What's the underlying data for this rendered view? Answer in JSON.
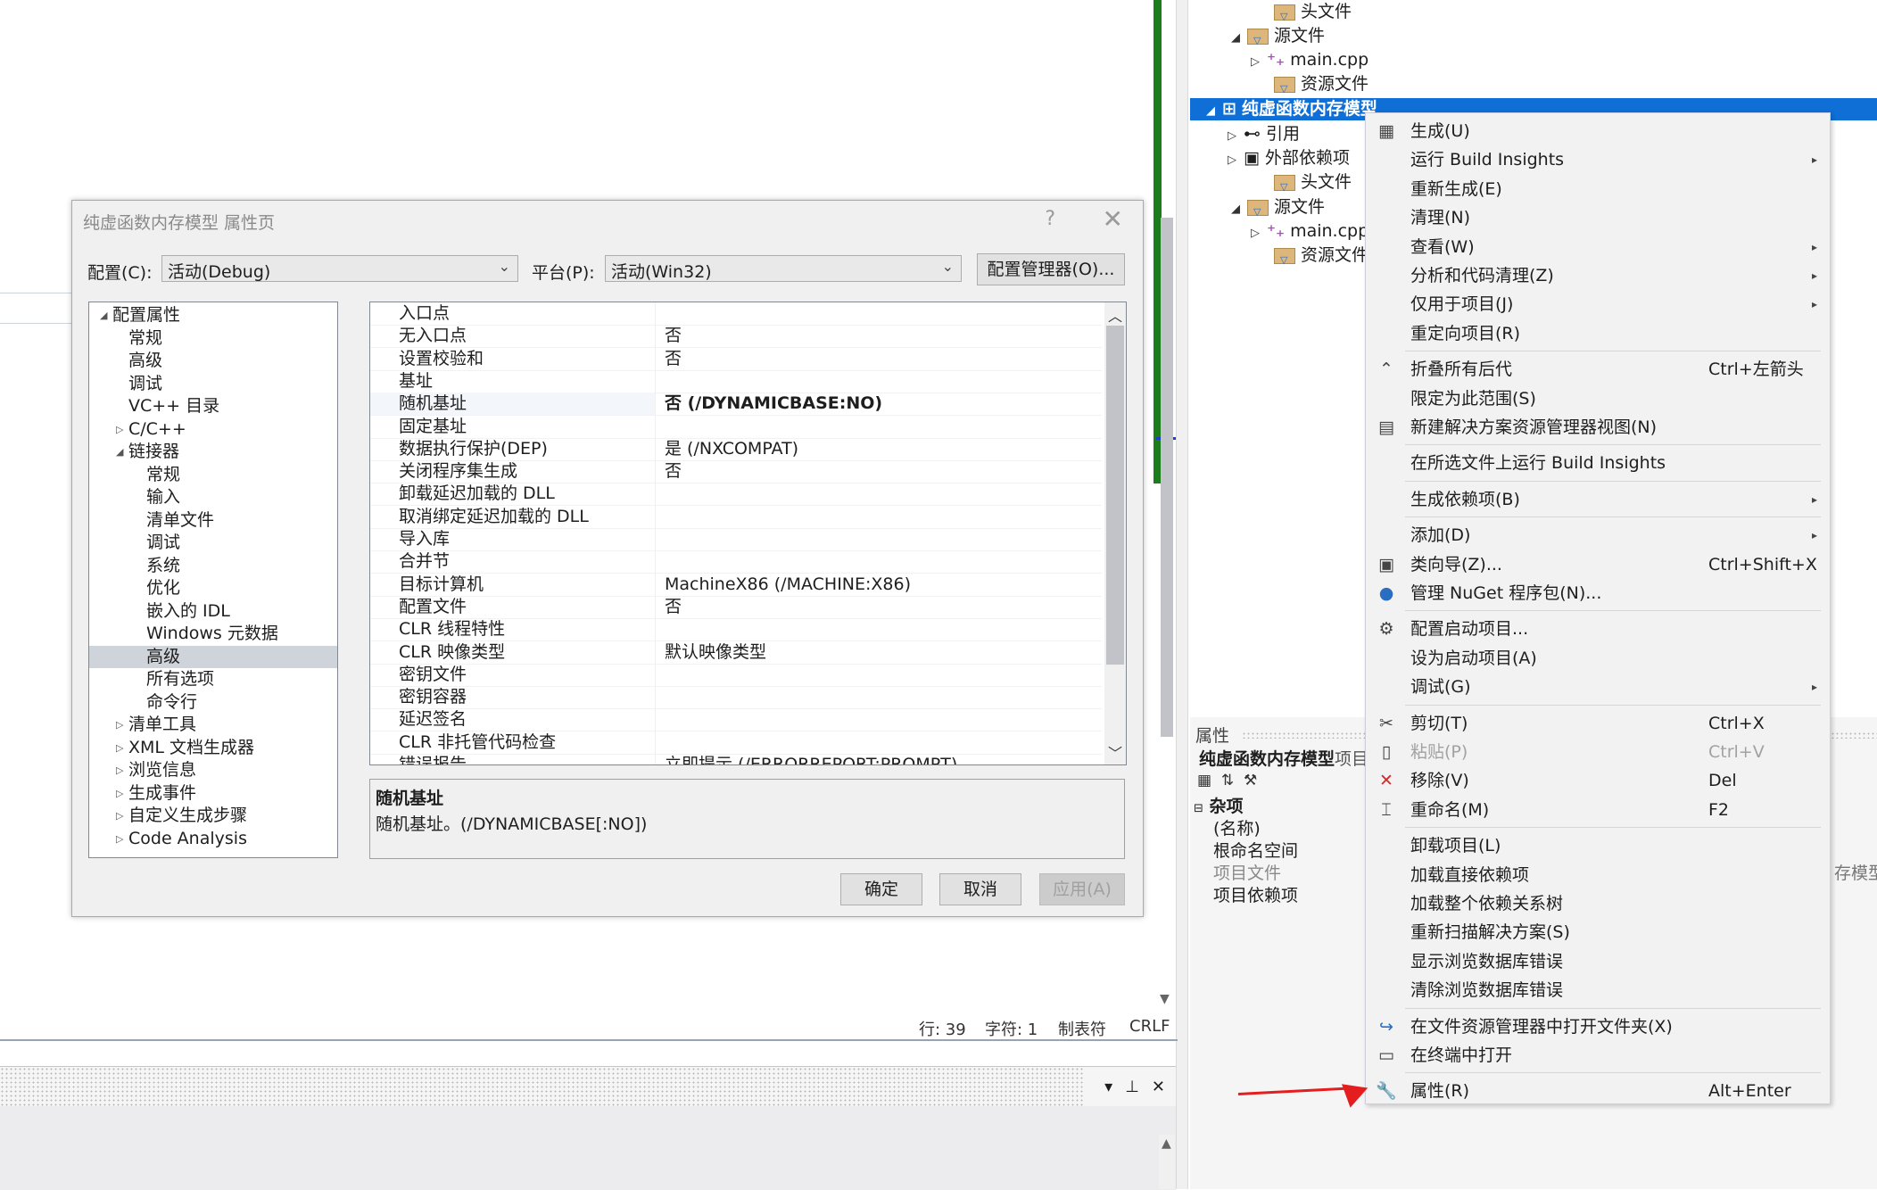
{
  "dialog": {
    "title": "纯虚函数内存模型 属性页",
    "help": "?",
    "close": "✕",
    "config_label": "配置(C):",
    "config_value": "活动(Debug)",
    "platform_label": "平台(P):",
    "platform_value": "活动(Win32)",
    "config_manager": "配置管理器(O)...",
    "tree": [
      {
        "label": "配置属性",
        "indent": 0,
        "toggle": "◢"
      },
      {
        "label": "常规",
        "indent": 1,
        "toggle": ""
      },
      {
        "label": "高级",
        "indent": 1,
        "toggle": ""
      },
      {
        "label": "调试",
        "indent": 1,
        "toggle": ""
      },
      {
        "label": "VC++ 目录",
        "indent": 1,
        "toggle": ""
      },
      {
        "label": "C/C++",
        "indent": 1,
        "toggle": "▷"
      },
      {
        "label": "链接器",
        "indent": 1,
        "toggle": "◢"
      },
      {
        "label": "常规",
        "indent": 2,
        "toggle": ""
      },
      {
        "label": "输入",
        "indent": 2,
        "toggle": ""
      },
      {
        "label": "清单文件",
        "indent": 2,
        "toggle": ""
      },
      {
        "label": "调试",
        "indent": 2,
        "toggle": ""
      },
      {
        "label": "系统",
        "indent": 2,
        "toggle": ""
      },
      {
        "label": "优化",
        "indent": 2,
        "toggle": ""
      },
      {
        "label": "嵌入的 IDL",
        "indent": 2,
        "toggle": ""
      },
      {
        "label": "Windows 元数据",
        "indent": 2,
        "toggle": ""
      },
      {
        "label": "高级",
        "indent": 2,
        "toggle": ""
      },
      {
        "label": "所有选项",
        "indent": 2,
        "toggle": ""
      },
      {
        "label": "命令行",
        "indent": 2,
        "toggle": ""
      },
      {
        "label": "清单工具",
        "indent": 1,
        "toggle": "▷"
      },
      {
        "label": "XML 文档生成器",
        "indent": 1,
        "toggle": "▷"
      },
      {
        "label": "浏览信息",
        "indent": 1,
        "toggle": "▷"
      },
      {
        "label": "生成事件",
        "indent": 1,
        "toggle": "▷"
      },
      {
        "label": "自定义生成步骤",
        "indent": 1,
        "toggle": "▷"
      },
      {
        "label": "Code Analysis",
        "indent": 1,
        "toggle": "▷"
      }
    ],
    "properties": [
      {
        "name": "入口点",
        "value": ""
      },
      {
        "name": "无入口点",
        "value": "否"
      },
      {
        "name": "设置校验和",
        "value": "否"
      },
      {
        "name": "基址",
        "value": ""
      },
      {
        "name": "随机基址",
        "value": "否 (/DYNAMICBASE:NO)"
      },
      {
        "name": "固定基址",
        "value": ""
      },
      {
        "name": "数据执行保护(DEP)",
        "value": "是 (/NXCOMPAT)"
      },
      {
        "name": "关闭程序集生成",
        "value": "否"
      },
      {
        "name": "卸载延迟加载的 DLL",
        "value": ""
      },
      {
        "name": "取消绑定延迟加载的 DLL",
        "value": ""
      },
      {
        "name": "导入库",
        "value": ""
      },
      {
        "name": "合并节",
        "value": ""
      },
      {
        "name": "目标计算机",
        "value": "MachineX86 (/MACHINE:X86)"
      },
      {
        "name": "配置文件",
        "value": "否"
      },
      {
        "name": "CLR 线程特性",
        "value": ""
      },
      {
        "name": "CLR 映像类型",
        "value": "默认映像类型"
      },
      {
        "name": "密钥文件",
        "value": ""
      },
      {
        "name": "密钥容器",
        "value": ""
      },
      {
        "name": "延迟签名",
        "value": ""
      },
      {
        "name": "CLR 非托管代码检查",
        "value": ""
      },
      {
        "name": "错误报告",
        "value": "立即提示 (/ERRORREPORT:PROMPT)"
      }
    ],
    "desc_title": "随机基址",
    "desc_text": "随机基址。(/DYNAMICBASE[:NO])",
    "ok": "确定",
    "cancel": "取消",
    "apply": "应用(A)"
  },
  "status": {
    "line": "行: 39",
    "char": "字符: 1",
    "tabs": "制表符",
    "eol": "CRLF"
  },
  "bottom_panel": {
    "dropdown": "▾",
    "pin": "⊥",
    "close": "✕"
  },
  "solution": {
    "items": [
      {
        "label": "头文件",
        "type": "folder",
        "arrow": ""
      },
      {
        "label": "源文件",
        "type": "folder",
        "arrow": "◢"
      },
      {
        "label": "main.cpp",
        "type": "cpp",
        "arrow": "▷"
      },
      {
        "label": "资源文件",
        "type": "folder",
        "arrow": ""
      },
      {
        "label": "纯虚函数内存模型",
        "type": "project",
        "arrow": "◢"
      },
      {
        "label": "引用",
        "type": "ref",
        "arrow": "▷"
      },
      {
        "label": "外部依赖项",
        "type": "ext",
        "arrow": "▷"
      },
      {
        "label": "头文件",
        "type": "folder",
        "arrow": ""
      },
      {
        "label": "源文件",
        "type": "folder",
        "arrow": "◢"
      },
      {
        "label": "main.cpp",
        "type": "cpp",
        "arrow": "▷"
      },
      {
        "label": "资源文件",
        "type": "folder",
        "arrow": ""
      }
    ]
  },
  "properties_panel": {
    "header": "属性",
    "object": "纯虚函数内存模型",
    "object_suffix": "项目",
    "group": "杂项",
    "rows": [
      "(名称)",
      "根命名空间",
      "项目文件",
      "项目依赖项"
    ],
    "right_value": "存模型"
  },
  "context_menu": {
    "items": [
      {
        "icon": "build-icon",
        "glyph": "▦",
        "label": "生成(U)",
        "shortcut": "",
        "sub": false,
        "disabled": false
      },
      {
        "icon": "",
        "glyph": "",
        "label": "运行 Build Insights",
        "shortcut": "",
        "sub": true,
        "disabled": false
      },
      {
        "icon": "",
        "glyph": "",
        "label": "重新生成(E)",
        "shortcut": "",
        "sub": false,
        "disabled": false
      },
      {
        "icon": "",
        "glyph": "",
        "label": "清理(N)",
        "shortcut": "",
        "sub": false,
        "disabled": false
      },
      {
        "icon": "",
        "glyph": "",
        "label": "查看(W)",
        "shortcut": "",
        "sub": true,
        "disabled": false
      },
      {
        "icon": "",
        "glyph": "",
        "label": "分析和代码清理(Z)",
        "shortcut": "",
        "sub": true,
        "disabled": false
      },
      {
        "icon": "",
        "glyph": "",
        "label": "仅用于项目(J)",
        "shortcut": "",
        "sub": true,
        "disabled": false
      },
      {
        "icon": "",
        "glyph": "",
        "label": "重定向项目(R)",
        "shortcut": "",
        "sub": false,
        "disabled": false
      },
      {
        "sep": true
      },
      {
        "icon": "collapse-icon",
        "glyph": "⌃",
        "label": "折叠所有后代",
        "shortcut": "Ctrl+左箭头",
        "sub": false,
        "disabled": false
      },
      {
        "icon": "",
        "glyph": "",
        "label": "限定为此范围(S)",
        "shortcut": "",
        "sub": false,
        "disabled": false
      },
      {
        "icon": "new-view-icon",
        "glyph": "▤",
        "label": "新建解决方案资源管理器视图(N)",
        "shortcut": "",
        "sub": false,
        "disabled": false
      },
      {
        "sep": true
      },
      {
        "icon": "",
        "glyph": "",
        "label": "在所选文件上运行 Build Insights",
        "shortcut": "",
        "sub": false,
        "disabled": false
      },
      {
        "sep": true
      },
      {
        "icon": "",
        "glyph": "",
        "label": "生成依赖项(B)",
        "shortcut": "",
        "sub": true,
        "disabled": false
      },
      {
        "sep": true
      },
      {
        "icon": "",
        "glyph": "",
        "label": "添加(D)",
        "shortcut": "",
        "sub": true,
        "disabled": false
      },
      {
        "icon": "class-wizard-icon",
        "glyph": "▣",
        "label": "类向导(Z)...",
        "shortcut": "Ctrl+Shift+X",
        "sub": false,
        "disabled": false
      },
      {
        "icon": "nuget-icon",
        "glyph": "●",
        "label": "管理 NuGet 程序包(N)...",
        "shortcut": "",
        "sub": false,
        "disabled": false
      },
      {
        "sep": true
      },
      {
        "icon": "gear-icon",
        "glyph": "⚙",
        "label": "配置启动项目...",
        "shortcut": "",
        "sub": false,
        "disabled": false
      },
      {
        "icon": "",
        "glyph": "",
        "label": "设为启动项目(A)",
        "shortcut": "",
        "sub": false,
        "disabled": false
      },
      {
        "icon": "",
        "glyph": "",
        "label": "调试(G)",
        "shortcut": "",
        "sub": true,
        "disabled": false
      },
      {
        "sep": true
      },
      {
        "icon": "scissors-icon",
        "glyph": "✂",
        "label": "剪切(T)",
        "shortcut": "Ctrl+X",
        "sub": false,
        "disabled": false
      },
      {
        "icon": "paste-icon",
        "glyph": "▯",
        "label": "粘贴(P)",
        "shortcut": "Ctrl+V",
        "sub": false,
        "disabled": true
      },
      {
        "icon": "remove-icon",
        "glyph": "✕",
        "label": "移除(V)",
        "shortcut": "Del",
        "sub": false,
        "disabled": false
      },
      {
        "icon": "rename-icon",
        "glyph": "⌶",
        "label": "重命名(M)",
        "shortcut": "F2",
        "sub": false,
        "disabled": false
      },
      {
        "sep": true
      },
      {
        "icon": "",
        "glyph": "",
        "label": "卸载项目(L)",
        "shortcut": "",
        "sub": false,
        "disabled": false
      },
      {
        "icon": "",
        "glyph": "",
        "label": "加载直接依赖项",
        "shortcut": "",
        "sub": false,
        "disabled": false
      },
      {
        "icon": "",
        "glyph": "",
        "label": "加载整个依赖关系树",
        "shortcut": "",
        "sub": false,
        "disabled": false
      },
      {
        "icon": "",
        "glyph": "",
        "label": "重新扫描解决方案(S)",
        "shortcut": "",
        "sub": false,
        "disabled": false
      },
      {
        "icon": "",
        "glyph": "",
        "label": "显示浏览数据库错误",
        "shortcut": "",
        "sub": false,
        "disabled": false
      },
      {
        "icon": "",
        "glyph": "",
        "label": "清除浏览数据库错误",
        "shortcut": "",
        "sub": false,
        "disabled": false
      },
      {
        "sep": true
      },
      {
        "icon": "open-folder-icon",
        "glyph": "↪",
        "label": "在文件资源管理器中打开文件夹(X)",
        "shortcut": "",
        "sub": false,
        "disabled": false
      },
      {
        "icon": "terminal-icon",
        "glyph": "▭",
        "label": "在终端中打开",
        "shortcut": "",
        "sub": false,
        "disabled": false
      },
      {
        "sep": true
      },
      {
        "icon": "wrench-icon",
        "glyph": "🔧",
        "label": "属性(R)",
        "shortcut": "Alt+Enter",
        "sub": false,
        "disabled": false
      }
    ]
  },
  "colors": {
    "selection": "#0f6fd6",
    "annotation_arrow": "#e41e1e",
    "green_margin": "#1b7d1b"
  }
}
